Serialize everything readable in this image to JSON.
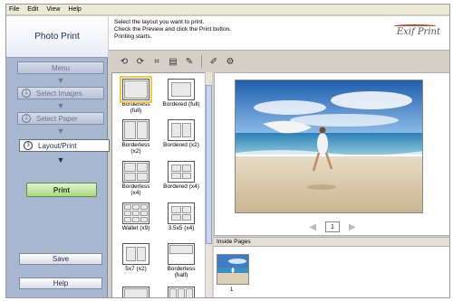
{
  "menu": [
    "File",
    "Edit",
    "View",
    "Help"
  ],
  "app": {
    "title": "Photo Print",
    "brand": "Exif Print"
  },
  "steps": {
    "menu": "Menu",
    "select_images": {
      "num": "1",
      "label": "Select Images"
    },
    "select_paper": {
      "num": "2",
      "label": "Select Paper"
    },
    "layout_print": {
      "num": "3",
      "label": "Layout/Print"
    }
  },
  "buttons": {
    "print": "Print",
    "save": "Save",
    "help": "Help"
  },
  "instructions": [
    "Select the layout you want to print.",
    "Check the Preview and click the Print button.",
    "Printing starts."
  ],
  "layouts": [
    {
      "label1": "Borderless",
      "label2": "(full)",
      "selected": true
    },
    {
      "label1": "Bordered (full)",
      "label2": ""
    },
    {
      "label1": "Borderless",
      "label2": "(x2)"
    },
    {
      "label1": "Bordered (x2)",
      "label2": ""
    },
    {
      "label1": "Borderless",
      "label2": "(x4)"
    },
    {
      "label1": "Bordered (x4)",
      "label2": ""
    },
    {
      "label1": "Wallet (x9)",
      "label2": ""
    },
    {
      "label1": "3.5x5 (x4)",
      "label2": ""
    },
    {
      "label1": "5x7 (x2)",
      "label2": ""
    },
    {
      "label1": "Borderless",
      "label2": "(half)"
    }
  ],
  "pager": {
    "page": "1",
    "prev_icon": "chevron-left-icon",
    "next_icon": "chevron-right-icon"
  },
  "inside_pages": {
    "header": "Inside Pages",
    "page_label": "1"
  },
  "colors": {
    "panel": "#a7b7cf",
    "print_button": "#a8d97f",
    "selection": "#f5c74a",
    "sky": "#2c6fb8",
    "sand": "#d9c9a6"
  }
}
